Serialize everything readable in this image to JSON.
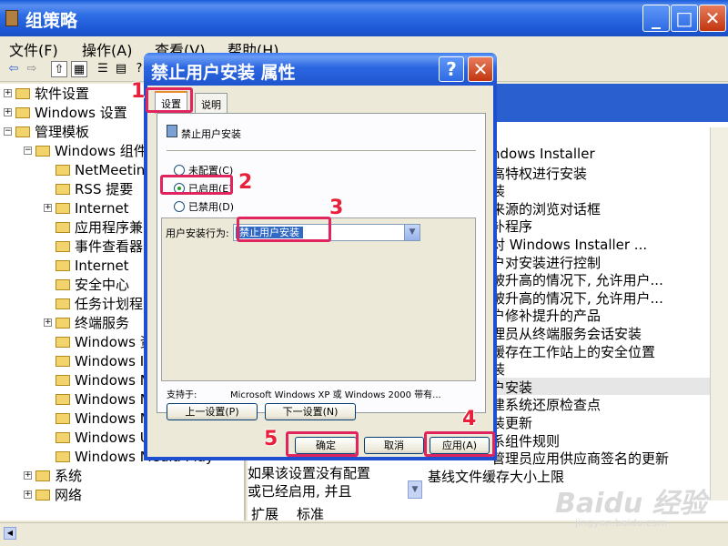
{
  "main_window": {
    "title": "组策略",
    "controls": {
      "minimize": "_",
      "maximize": "□",
      "close": "✕"
    }
  },
  "menubar": [
    "文件(F)",
    "操作(A)",
    "查看(V)",
    "帮助(H)"
  ],
  "toolbar_icons": [
    "back-arrow-icon",
    "forward-arrow-icon",
    "up-folder-icon",
    "show-tree-icon",
    "properties-icon",
    "export-icon",
    "help-icon"
  ],
  "tree": [
    {
      "label": "软件设置",
      "indent": 0,
      "expander": "+"
    },
    {
      "label": "Windows 设置",
      "indent": 0,
      "expander": "+"
    },
    {
      "label": "管理模板",
      "indent": 0,
      "expander": "−"
    },
    {
      "label": "Windows 组件",
      "indent": 1,
      "expander": "−"
    },
    {
      "label": "NetMeeting",
      "indent": 2,
      "expander": ""
    },
    {
      "label": "RSS 提要",
      "indent": 2,
      "expander": ""
    },
    {
      "label": "Internet",
      "indent": 2,
      "expander": "+"
    },
    {
      "label": "应用程序兼",
      "indent": 2,
      "expander": ""
    },
    {
      "label": "事件查看器",
      "indent": 2,
      "expander": ""
    },
    {
      "label": "Internet",
      "indent": 2,
      "expander": ""
    },
    {
      "label": "安全中心",
      "indent": 2,
      "expander": ""
    },
    {
      "label": "任务计划程",
      "indent": 2,
      "expander": ""
    },
    {
      "label": "终端服务",
      "indent": 2,
      "expander": "+"
    },
    {
      "label": "Windows 资",
      "indent": 2,
      "expander": ""
    },
    {
      "label": "Windows I",
      "indent": 2,
      "expander": ""
    },
    {
      "label": "Windows M",
      "indent": 2,
      "expander": ""
    },
    {
      "label": "Windows M",
      "indent": 2,
      "expander": ""
    },
    {
      "label": "Windows M",
      "indent": 2,
      "expander": ""
    },
    {
      "label": "Windows U",
      "indent": 2,
      "expander": ""
    },
    {
      "label": "Windows Media Play",
      "indent": 2,
      "expander": ""
    },
    {
      "label": "系统",
      "indent": 1,
      "expander": "+"
    },
    {
      "label": "网络",
      "indent": 1,
      "expander": "+"
    }
  ],
  "right_list": [
    "ndows Installer",
    "高特权进行安装",
    "装",
    "来源的浏览对话框",
    "补程序",
    " 对 Windows Installer ...",
    "户对安装进行控制",
    "被升高的情况下, 允许用户...",
    "被升高的情况下, 允许用户...",
    "户修补提升的产品",
    "理员从终端服务会话安装",
    "缓存在工作站上的安全位置",
    "装",
    "户安装",
    "建系统还原检查点",
    "装更新",
    "系组件规则",
    "管理员应用供应商签名的更新",
    "基线文件缓存大小上限"
  ],
  "right_selected_index": 13,
  "description": [
    "如果该设置没有配置",
    "或已经启用, 并且"
  ],
  "bottom_tabs": [
    "扩展",
    "标准"
  ],
  "dialog": {
    "title": "禁止用户安装 属性",
    "help_button": "?",
    "close_button": "✕",
    "tabs": [
      "设置",
      "说明"
    ],
    "policy_name": "禁止用户安装",
    "radios": [
      {
        "label": "未配置(C)",
        "checked": false
      },
      {
        "label": "已启用(E)",
        "checked": true
      },
      {
        "label": "已禁用(D)",
        "checked": false
      }
    ],
    "option_label": "用户安装行为:",
    "option_value": "禁止用户安装",
    "supported_label": "支持于:",
    "supported_value": "Microsoft Windows XP 或 Windows 2000 带有...",
    "prev_button": "上一设置(P)",
    "next_button": "下一设置(N)",
    "ok_button": "确定",
    "cancel_button": "取消",
    "apply_button": "应用(A)"
  },
  "annotations": [
    "1",
    "2",
    "3",
    "4",
    "5"
  ],
  "watermark": {
    "text": "Baidu 经验",
    "sub": "jingyan.baidu.com"
  }
}
